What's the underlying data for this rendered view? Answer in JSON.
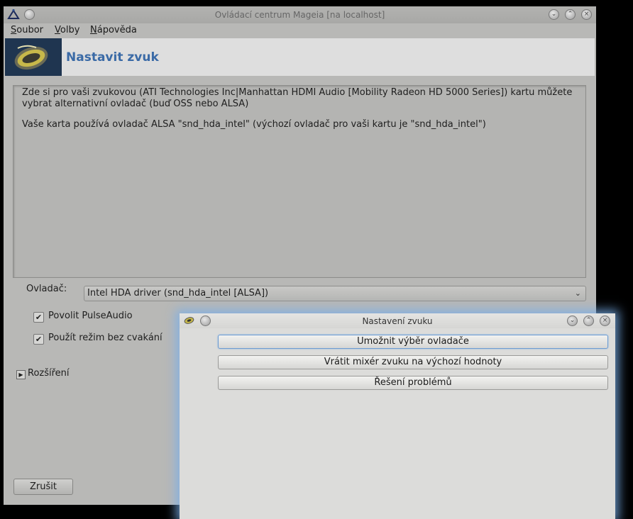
{
  "main_window": {
    "title": "Ovládací centrum Mageia  [na localhost]",
    "menu": [
      {
        "accel": "S",
        "rest": "oubor"
      },
      {
        "accel": "V",
        "rest": "olby"
      },
      {
        "accel": "N",
        "rest": "ápověda"
      }
    ],
    "page_title": "Nastavit zvuk",
    "description": [
      "Zde si pro vaši zvukovou (ATI Technologies Inc|Manhattan HDMI Audio [Mobility Radeon HD 5000 Series]) kartu můžete vybrat alternativní ovladač (buď OSS nebo ALSA)",
      "Vaše karta používá ovladač ALSA \"snd_hda_intel\" (výchozí ovladač pro vaši kartu je \"snd_hda_intel\")"
    ],
    "driver_label": "Ovladač:",
    "driver_value": "Intel HDA driver (snd_hda_intel [ALSA])",
    "checkboxes": [
      {
        "label": "Povolit PulseAudio",
        "checked": true
      },
      {
        "label": "Použít režim bez cvakání",
        "checked": true
      }
    ],
    "expander_label": "Rozšíření",
    "cancel_label": "Zrušit"
  },
  "dialog": {
    "title": "Nastavení zvuku",
    "buttons": [
      "Umožnit výběr ovladače",
      "Vrátit mixér zvuku na výchozí hodnoty",
      "Řešení problémů"
    ]
  },
  "icons": {
    "app_logo": "mageia-logo-icon",
    "speaker": "speaker-icon"
  },
  "colors": {
    "title_accent": "#3a6aa6",
    "focus_glow": "#78afeb",
    "header_logo_bg": "#1f3550"
  }
}
